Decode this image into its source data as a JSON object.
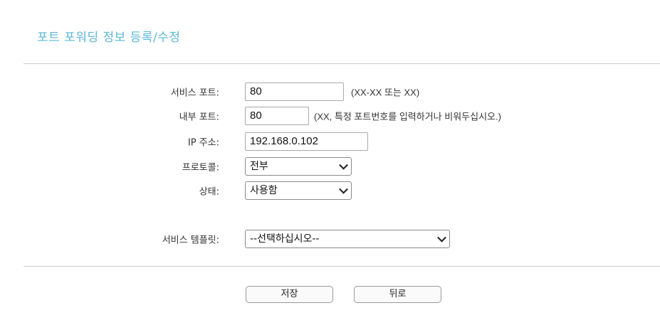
{
  "page": {
    "title": "포트 포워딩 정보 등록/수정"
  },
  "form": {
    "service_port": {
      "label": "서비스 포트:",
      "value": "80",
      "hint": "(XX-XX 또는 XX)"
    },
    "internal_port": {
      "label": "내부 포트:",
      "value": "80",
      "hint": "(XX, 특정 포트번호를 입력하거나 비워두십시오.)"
    },
    "ip_address": {
      "label": "IP 주소:",
      "value": "192.168.0.102"
    },
    "protocol": {
      "label": "프로토콜:",
      "selected": "전부",
      "icon": "chevron-down-icon"
    },
    "status": {
      "label": "상태:",
      "selected": "사용함",
      "icon": "chevron-down-icon"
    },
    "service_template": {
      "label": "서비스 템플릿:",
      "selected": "--선택하십시오--",
      "icon": "chevron-down-icon"
    }
  },
  "buttons": {
    "save_label": "저장",
    "back_label": "뒤로"
  },
  "colors": {
    "title": "#5bb8d6",
    "divider": "#cfcfcf"
  }
}
